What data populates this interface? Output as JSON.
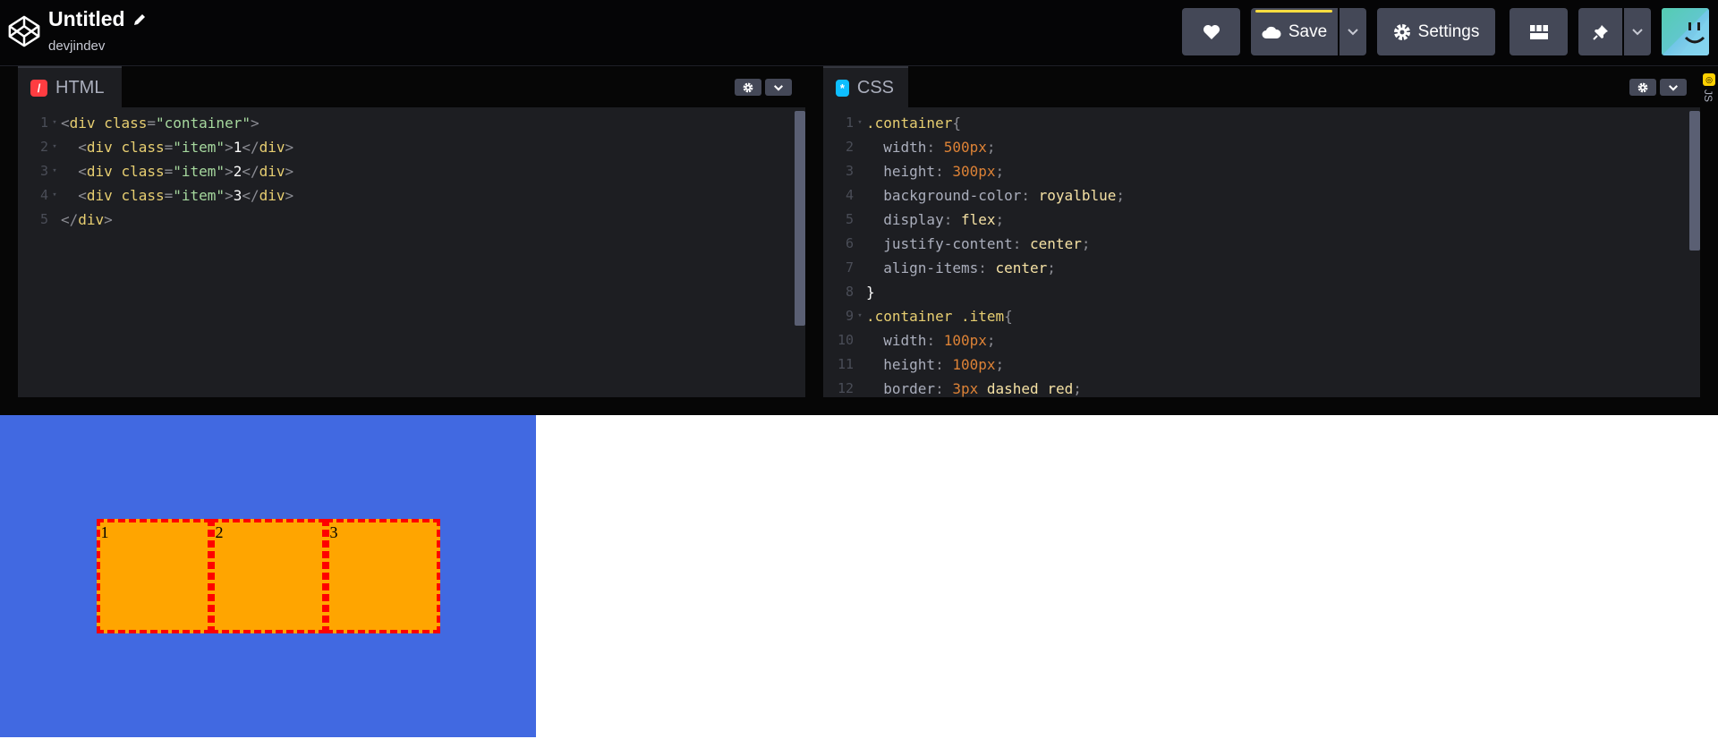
{
  "header": {
    "title": "Untitled",
    "username": "devjindev",
    "buttons": {
      "love": {
        "icon": "heart-icon"
      },
      "save": {
        "label": "Save",
        "icon": "cloud-icon"
      },
      "settings": {
        "label": "Settings",
        "icon": "gear-icon"
      },
      "layout": {
        "icon": "layout-icon"
      },
      "pin": {
        "icon": "pin-icon"
      }
    },
    "colors": {
      "save_accent": "#ffdd40"
    }
  },
  "editors": {
    "html": {
      "tab_label": "HTML",
      "icon_glyph": "/",
      "accent": "#ff3c41",
      "line_numbers": [
        "1",
        "2",
        "3",
        "4",
        "5"
      ]
    },
    "css": {
      "tab_label": "CSS",
      "icon_glyph": "*",
      "accent": "#0ebeff",
      "line_numbers": [
        "1",
        "2",
        "3",
        "4",
        "5",
        "6",
        "7",
        "8",
        "9",
        "10",
        "11",
        "12"
      ]
    },
    "js": {
      "tab_label": "JS"
    }
  },
  "preview": {
    "background": "royalblue",
    "item_color": "orange",
    "items": [
      "1",
      "2",
      "3"
    ]
  }
}
